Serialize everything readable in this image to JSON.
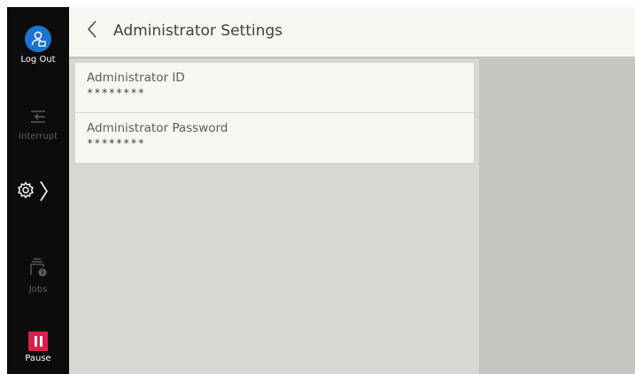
{
  "sidebar": {
    "logout_label": "Log Out",
    "interrupt_label": "Interrupt",
    "jobs_label": "Jobs",
    "pause_label": "Pause",
    "settings_chevron": "〉"
  },
  "header": {
    "title": "Administrator Settings"
  },
  "settings_list": [
    {
      "label": "Administrator ID",
      "value": "********"
    },
    {
      "label": "Administrator Password",
      "value": "********"
    }
  ],
  "colors": {
    "sidebar_bg": "#0c0c0c",
    "logout_blue": "#1a74cf",
    "pause_red": "#d9204e",
    "header_bg": "#f7f7f2",
    "content_bg": "#d8d8d3",
    "right_panel_bg": "#c5c5c0"
  },
  "icons": {
    "logout": "user-logout-icon",
    "interrupt": "interrupt-icon",
    "settings": "gear-icon",
    "jobs": "jobs-icon",
    "pause": "pause-icon",
    "back": "back-chevron-icon"
  }
}
